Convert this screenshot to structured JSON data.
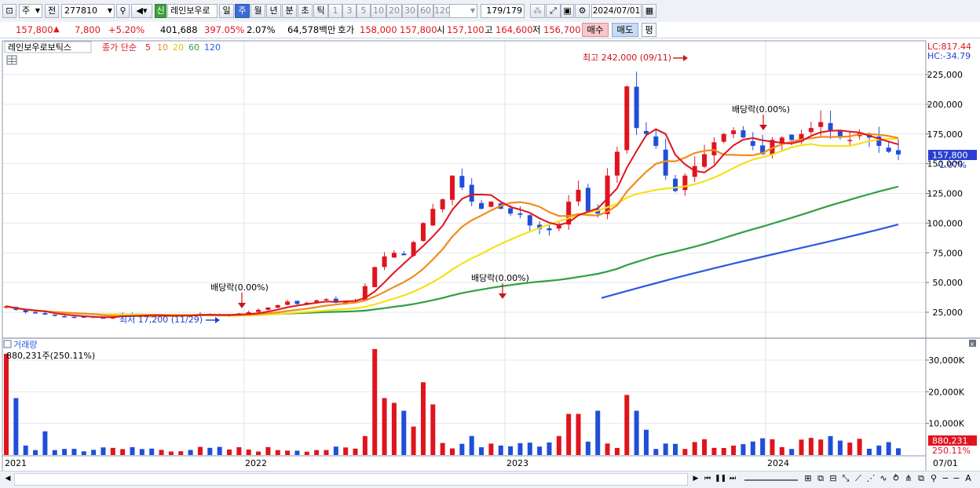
{
  "toolbar": {
    "market": "주",
    "prev_label": "전",
    "code": "277810",
    "new_badge": "신",
    "stock_name": "레인보우로",
    "periods": [
      "일",
      "주",
      "월",
      "년",
      "분",
      "초",
      "틱"
    ],
    "selected_period": "주",
    "numbers": [
      "1",
      "3",
      "5",
      "10",
      "20",
      "30",
      "60",
      "120"
    ],
    "count": "179",
    "count_total": "/179",
    "date": "2024/07/01"
  },
  "infobar": {
    "price": "157,800",
    "change": "7,800",
    "change_pct": "+5.20%",
    "volume": "401,688",
    "volume_ratio": "397.05%",
    "turnover": "2.07%",
    "amount": "64,578백만",
    "quote_label": "호가",
    "ask": "158,000",
    "bid": "157,800",
    "open_label": "시",
    "open": "157,100",
    "high_label": "고",
    "high": "164,600",
    "low_label": "저",
    "low": "156,700",
    "buy_label": "매수",
    "sell_label": "매도",
    "eval_label": "평"
  },
  "chart": {
    "stock_label": "레인보우로보틱스",
    "ma_label": "종가 단순",
    "ma_periods": [
      "5",
      "10",
      "20",
      "60",
      "120"
    ],
    "lc": "LC:817.44",
    "hc": "HC:-34.79",
    "price_ticks": [
      "225,000",
      "200,000",
      "175,000",
      "150,000",
      "125,000",
      "100,000",
      "75,000",
      "50,000",
      "25,000"
    ],
    "current_price_label": "157,800",
    "current_change_label": "-1.07%",
    "annotations": {
      "high": "최고 242,000 (09/11)",
      "low": "최저 17,200 (11/29)",
      "dividend1": "배당락(0.00%)",
      "dividend2": "배당락(0.00%)",
      "dividend3": "배당락(0.00%)"
    },
    "volume_title": "거래량",
    "volume_value": "880,231주(250.11%)",
    "volume_ticks": [
      "30,000K",
      "20,000K",
      "10,000K"
    ],
    "volume_current": "880,231",
    "volume_current_pct": "250.11%",
    "x_labels": [
      "2021",
      "2022",
      "2023",
      "2024"
    ],
    "x_end": "07/01",
    "colors": {
      "up": "#e0141e",
      "down": "#1f4fd8",
      "ma5": "#e0141e",
      "ma10": "#f08c1e",
      "ma20": "#f5e21a",
      "ma60": "#2ea043",
      "ma120": "#2a5ae0"
    }
  },
  "chart_data": {
    "type": "candlestick",
    "x_range": [
      "2021",
      "2024/07/01"
    ],
    "ylim": [
      0,
      245000
    ],
    "y_ticks": [
      25000,
      50000,
      75000,
      100000,
      125000,
      150000,
      175000,
      200000,
      225000
    ],
    "closes": [
      30000,
      27000,
      25000,
      24000,
      23000,
      22000,
      21500,
      21000,
      21000,
      20500,
      20000,
      22000,
      24000,
      23000,
      22000,
      21500,
      22000,
      22500,
      23000,
      22000,
      23500,
      23000,
      22000,
      23000,
      24000,
      25000,
      27000,
      29000,
      31000,
      34000,
      32000,
      33000,
      35000,
      36000,
      33000,
      34000,
      35000,
      47000,
      63000,
      72000,
      75000,
      73000,
      84000,
      100000,
      112000,
      120000,
      140000,
      130000,
      118000,
      112000,
      118000,
      112000,
      108000,
      107000,
      98000,
      95000,
      94000,
      98000,
      118000,
      128000,
      110000,
      108000,
      140000,
      160000,
      215000,
      180000,
      175000,
      165000,
      140000,
      127000,
      140000,
      148000,
      158000,
      168000,
      175000,
      178000,
      172000,
      165000,
      158000,
      170000,
      172000,
      170000,
      175000,
      180000,
      185000,
      178000,
      172000,
      170000,
      176000,
      172000,
      165000,
      160000,
      157800
    ],
    "high": {
      "value": 242000,
      "label": "09/11"
    },
    "low": {
      "value": 17200,
      "label": "11/29"
    },
    "volume_ylim": [
      0,
      35000000
    ],
    "volume_ticks": [
      10000000,
      20000000,
      30000000
    ],
    "last_volume": 880231
  }
}
